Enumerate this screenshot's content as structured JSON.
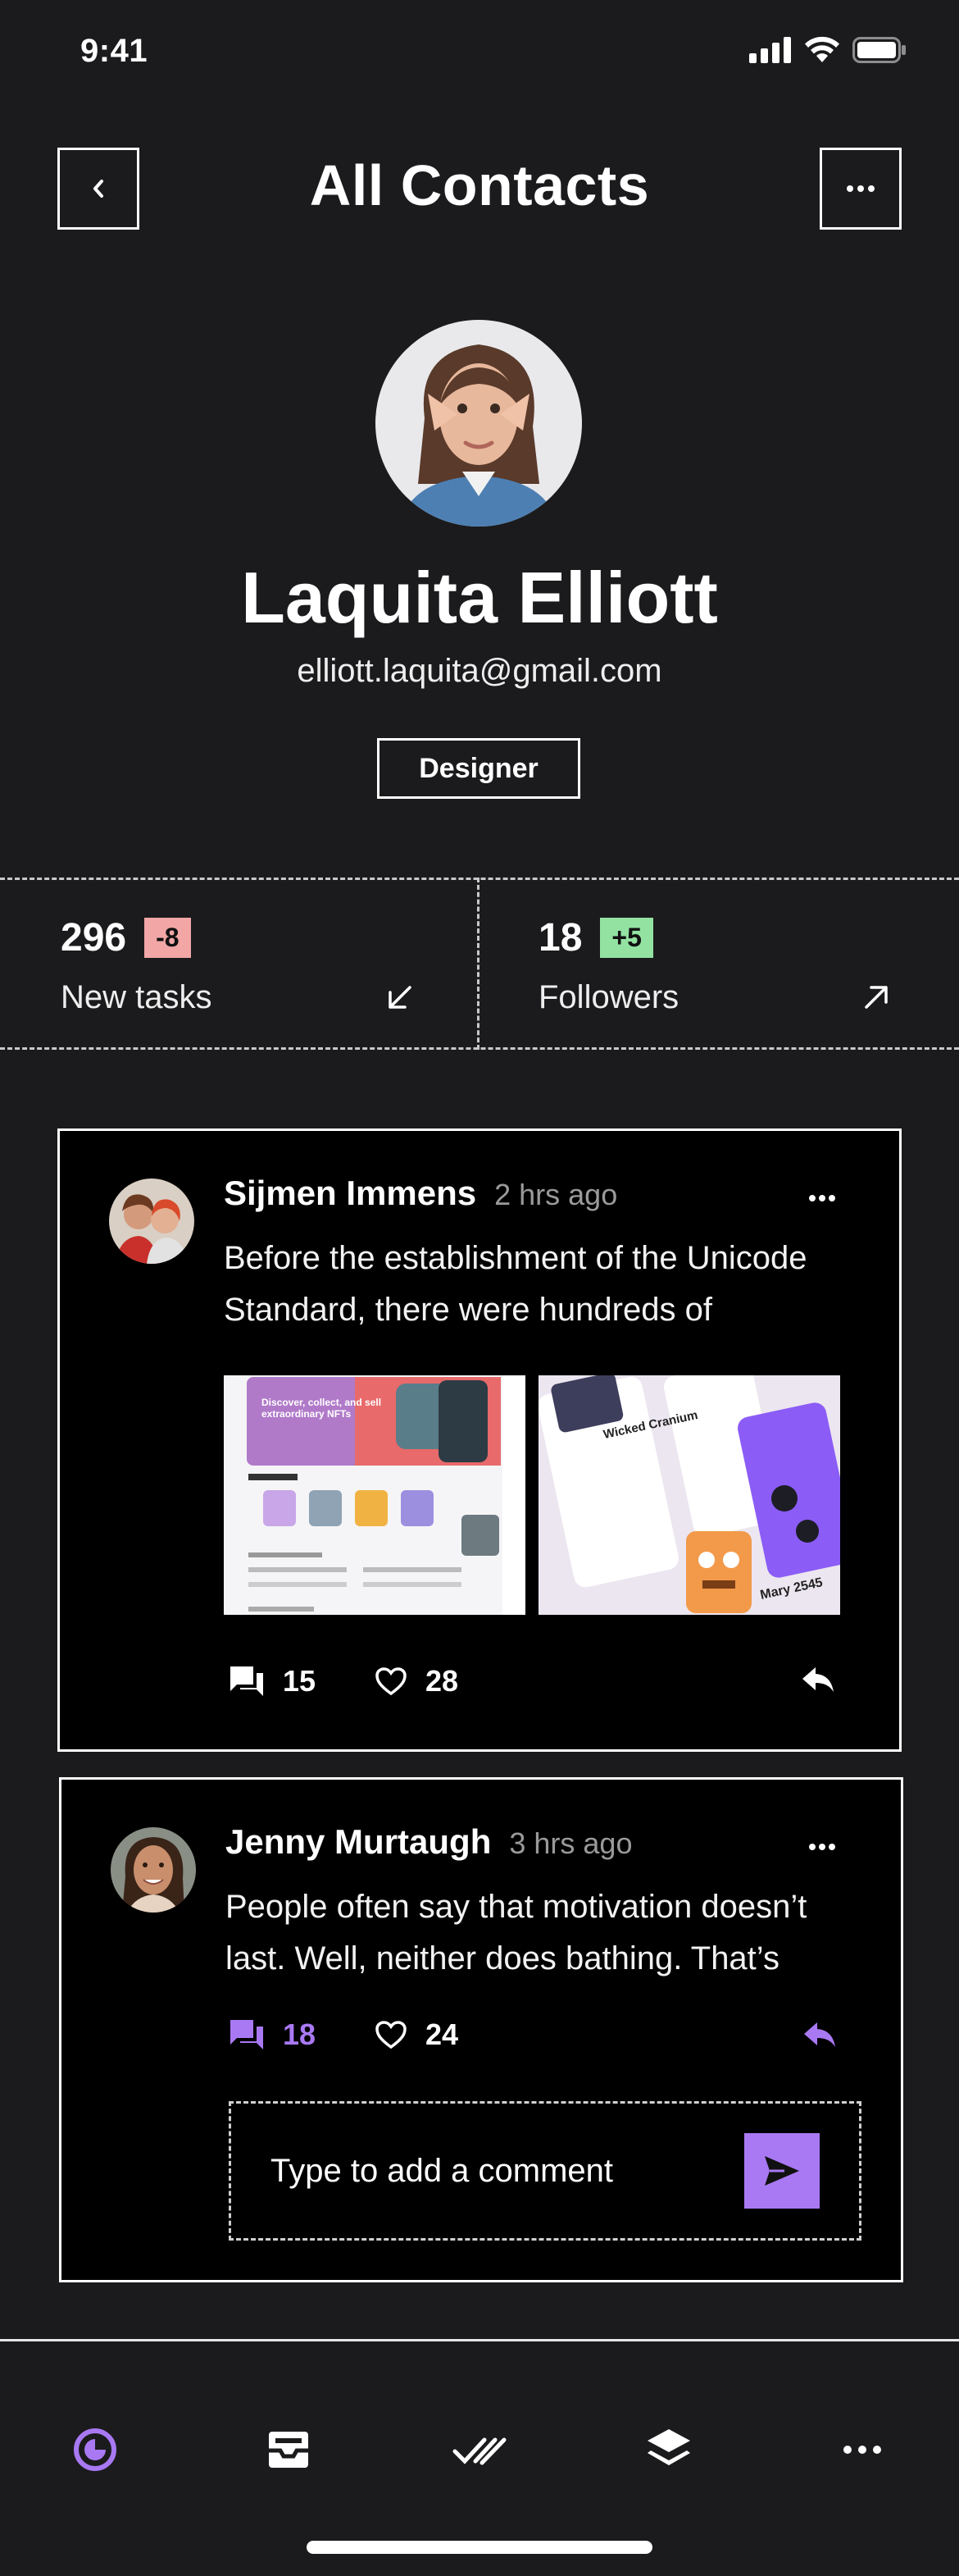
{
  "status": {
    "time": "9:41"
  },
  "header": {
    "title": "All Contacts"
  },
  "profile": {
    "name": "Laquita Elliott",
    "email": "elliott.laquita@gmail.com",
    "role": "Designer"
  },
  "stats": [
    {
      "value": "296",
      "delta": "-8",
      "delta_color": "#f2a6a6",
      "label": "New tasks"
    },
    {
      "value": "18",
      "delta": "+5",
      "delta_color": "#93e2a2",
      "label": "Followers"
    }
  ],
  "posts": [
    {
      "author": "Sijmen Immens",
      "time": "2 hrs ago",
      "text": "Before the establishment of the Unicode Standard, there were hundreds of",
      "comments": "15",
      "likes": "28",
      "thumb1": {
        "headline": "Discover, collect, and sell extraordinary NFTs"
      },
      "thumb2": {
        "headline": "Wicked Cranium",
        "footer": "Mary 2545"
      }
    },
    {
      "author": "Jenny Murtaugh",
      "time": "3 hrs ago",
      "text": "People often say that motivation doesn’t last. Well, neither does bathing. That’s",
      "comments": "18",
      "likes": "24",
      "comment_placeholder": "Type to add a comment"
    }
  ],
  "colors": {
    "accent": "#a979f4",
    "background": "#1b1b1d",
    "card": "#000000"
  }
}
